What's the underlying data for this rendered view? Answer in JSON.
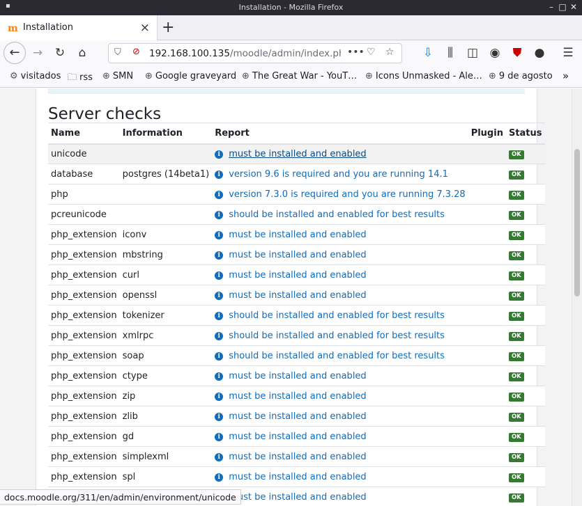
{
  "window": {
    "title": "Installation - Mozilla Firefox"
  },
  "tab": {
    "label": "Installation"
  },
  "url": {
    "host": "192.168.100.135",
    "path": "/moodle/admin/index.php?c"
  },
  "bookmarks": [
    "visitados",
    "rss",
    "SMN",
    "Google graveyard",
    "The Great War - YouT…",
    "Icons Unmasked - Ale…",
    "9 de agosto"
  ],
  "page": {
    "heading": "Server checks"
  },
  "table": {
    "headers": {
      "name": "Name",
      "information": "Information",
      "report": "Report",
      "plugin": "Plugin",
      "status": "Status"
    },
    "rows": [
      {
        "name": "unicode",
        "info": "",
        "report": "must be installed and enabled",
        "status": "OK"
      },
      {
        "name": "database",
        "info": "postgres (14beta1)",
        "report": "version 9.6 is required and you are running 14.1",
        "status": "OK"
      },
      {
        "name": "php",
        "info": "",
        "report": "version 7.3.0 is required and you are running 7.3.28",
        "status": "OK"
      },
      {
        "name": "pcreunicode",
        "info": "",
        "report": "should be installed and enabled for best results",
        "status": "OK"
      },
      {
        "name": "php_extension",
        "info": "iconv",
        "report": "must be installed and enabled",
        "status": "OK"
      },
      {
        "name": "php_extension",
        "info": "mbstring",
        "report": "must be installed and enabled",
        "status": "OK"
      },
      {
        "name": "php_extension",
        "info": "curl",
        "report": "must be installed and enabled",
        "status": "OK"
      },
      {
        "name": "php_extension",
        "info": "openssl",
        "report": "must be installed and enabled",
        "status": "OK"
      },
      {
        "name": "php_extension",
        "info": "tokenizer",
        "report": "should be installed and enabled for best results",
        "status": "OK"
      },
      {
        "name": "php_extension",
        "info": "xmlrpc",
        "report": "should be installed and enabled for best results",
        "status": "OK"
      },
      {
        "name": "php_extension",
        "info": "soap",
        "report": "should be installed and enabled for best results",
        "status": "OK"
      },
      {
        "name": "php_extension",
        "info": "ctype",
        "report": "must be installed and enabled",
        "status": "OK"
      },
      {
        "name": "php_extension",
        "info": "zip",
        "report": "must be installed and enabled",
        "status": "OK"
      },
      {
        "name": "php_extension",
        "info": "zlib",
        "report": "must be installed and enabled",
        "status": "OK"
      },
      {
        "name": "php_extension",
        "info": "gd",
        "report": "must be installed and enabled",
        "status": "OK"
      },
      {
        "name": "php_extension",
        "info": "simplexml",
        "report": "must be installed and enabled",
        "status": "OK"
      },
      {
        "name": "php_extension",
        "info": "spl",
        "report": "must be installed and enabled",
        "status": "OK"
      },
      {
        "name": "",
        "info": "",
        "report": "must be installed and enabled",
        "status": "OK"
      }
    ]
  },
  "statusbar": {
    "text": "docs.moodle.org/311/en/admin/environment/unicode"
  },
  "icons": {
    "back": "arrow-left-icon",
    "forward": "arrow-right-icon",
    "reload": "reload-icon",
    "home": "home-icon",
    "info": "info-icon",
    "download": "download-icon",
    "library": "library-icon",
    "sidebar": "sidebar-icon",
    "ublock": "ublock-icon",
    "menu": "hamburger-menu-icon"
  }
}
